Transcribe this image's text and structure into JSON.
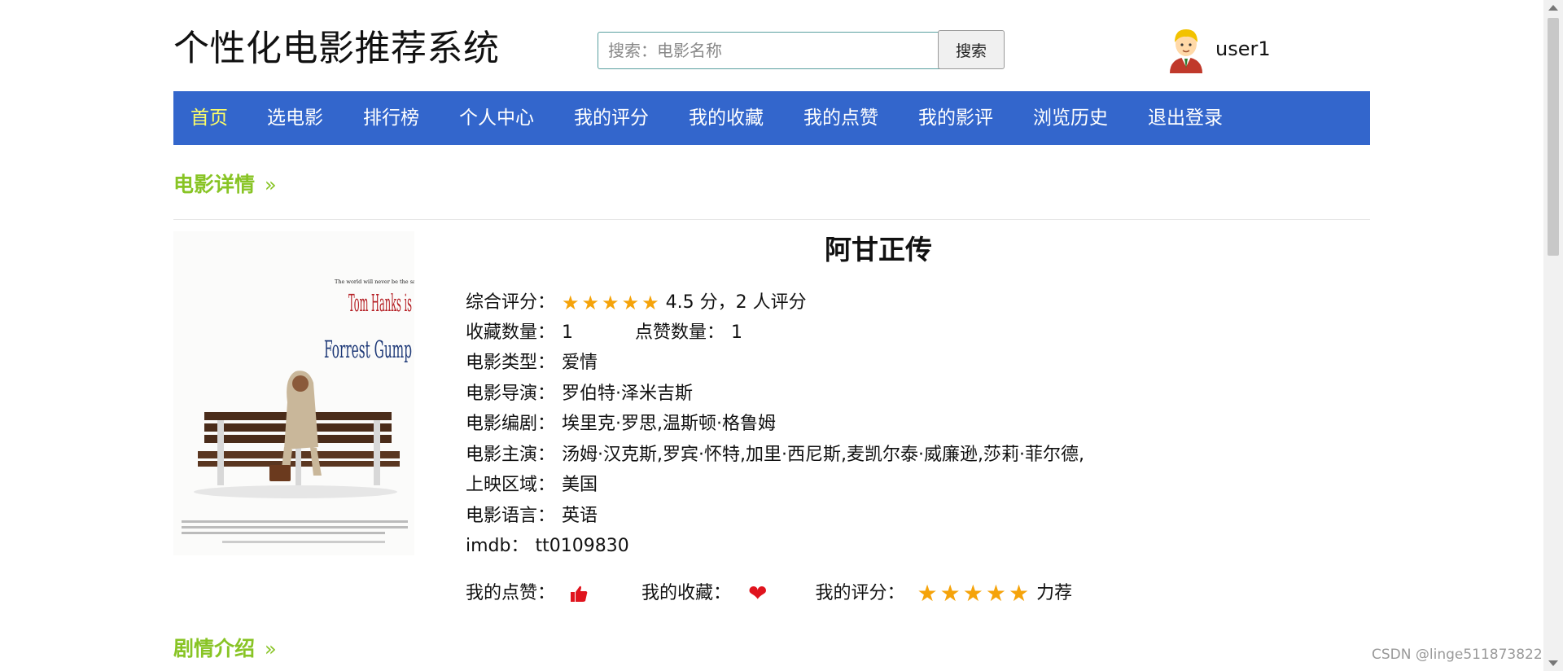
{
  "header": {
    "site_title": "个性化电影推荐系统",
    "search_placeholder": "搜索：电影名称",
    "search_button": "搜索",
    "username": "user1"
  },
  "nav": {
    "items": [
      {
        "label": "首页",
        "active": true
      },
      {
        "label": "选电影"
      },
      {
        "label": "排行榜"
      },
      {
        "label": "个人中心"
      },
      {
        "label": "我的评分"
      },
      {
        "label": "我的收藏"
      },
      {
        "label": "我的点赞"
      },
      {
        "label": "我的影评"
      },
      {
        "label": "浏览历史"
      },
      {
        "label": "退出登录"
      }
    ]
  },
  "sections": {
    "details": "电影详情",
    "plot": "剧情介绍"
  },
  "poster": {
    "icon": "movie-poster-image",
    "text": [
      "The world will never be the same once you've seen it through the eyes of Forrest Gump.",
      "Tom Hanks is",
      "Forrest Gump"
    ]
  },
  "movie": {
    "title": "阿甘正传",
    "rating_label": "综合评分：",
    "rating_stars": 5,
    "rating_text": "4.5 分，2 人评分",
    "collect_label": "收藏数量：",
    "collect_count": "1",
    "like_label": "点赞数量：",
    "like_count": "1",
    "genre_label": "电影类型：",
    "genre": "爱情",
    "director_label": "电影导演：",
    "director": "罗伯特·泽米吉斯",
    "writer_label": "电影编剧：",
    "writer": "埃里克·罗思,温斯顿·格鲁姆",
    "cast_label": "电影主演：",
    "cast": "汤姆·汉克斯,罗宾·怀特,加里·西尼斯,麦凯尔泰·威廉逊,莎莉·菲尔德,",
    "region_label": "上映区域：",
    "region": "美国",
    "language_label": "电影语言：",
    "language": "英语",
    "imdb_label": "imdb：",
    "imdb": "tt0109830"
  },
  "my_actions": {
    "like_label": "我的点赞：",
    "collect_label": "我的收藏：",
    "rate_label": "我的评分：",
    "my_stars": 5,
    "rate_text": "力荐"
  },
  "watermark": "CSDN @linge511873822",
  "colors": {
    "nav_bg": "#3366cc",
    "nav_active": "#ffff66",
    "section_green": "#88c425",
    "star": "#f5a30a",
    "heart": "#e0141e"
  }
}
